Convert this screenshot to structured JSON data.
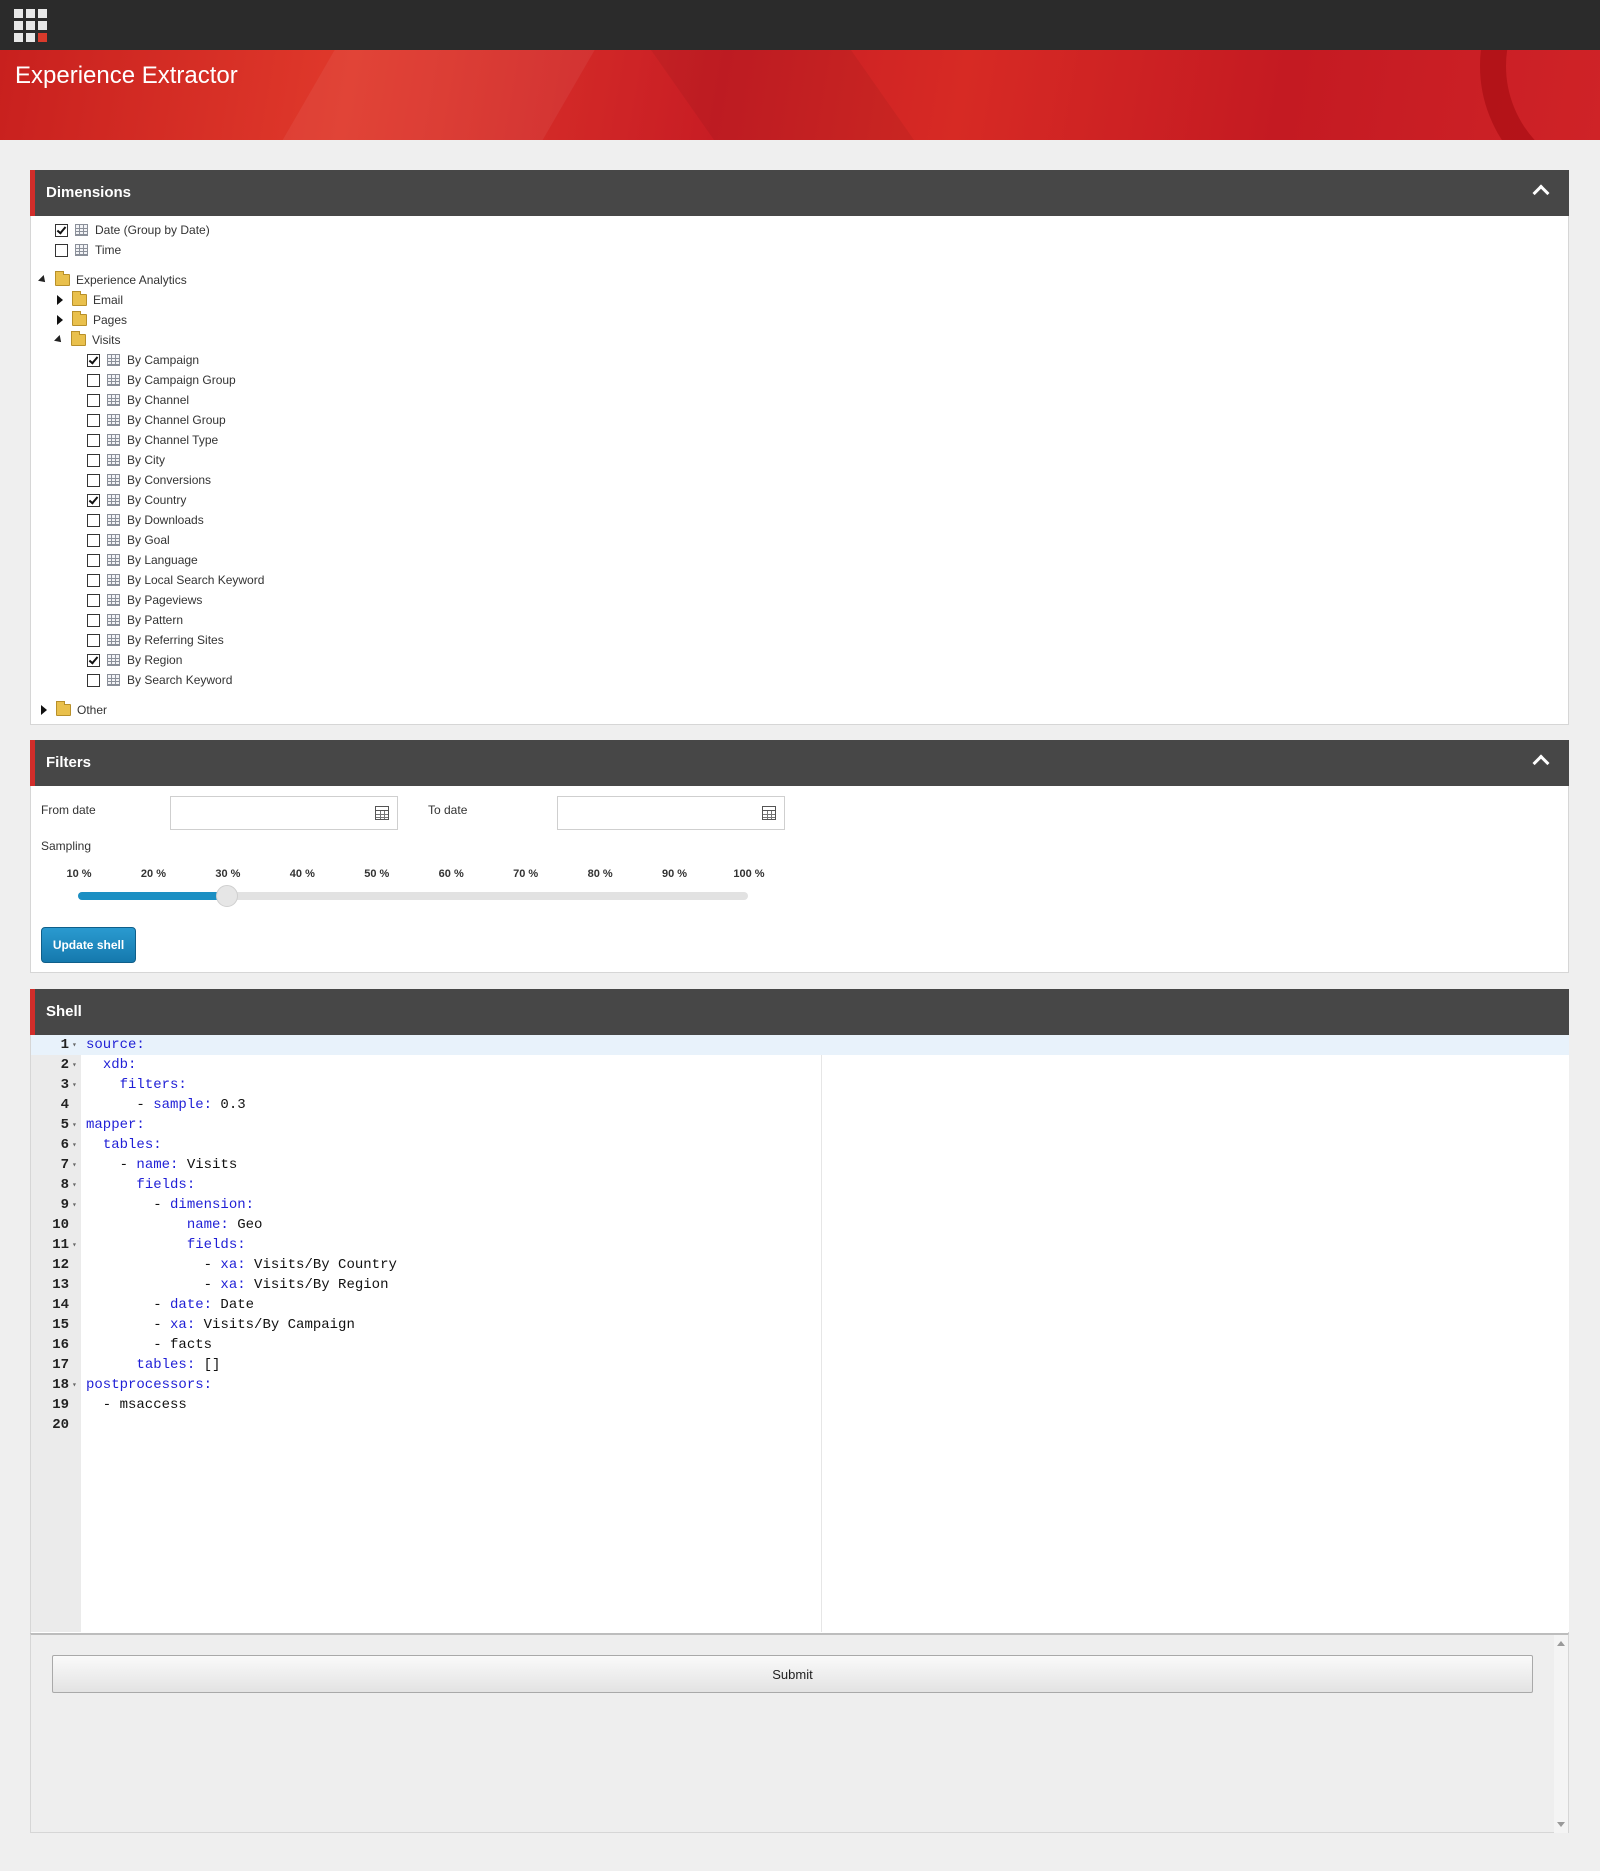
{
  "app": {
    "title": "Experience Extractor"
  },
  "dimensions": {
    "title": "Dimensions",
    "top_items": [
      {
        "label": "Date (Group by Date)",
        "checked": true
      },
      {
        "label": "Time",
        "checked": false
      }
    ],
    "folder_experience": "Experience Analytics",
    "folder_email": "Email",
    "folder_pages": "Pages",
    "folder_visits": "Visits",
    "visits_items": [
      {
        "label": "By Campaign",
        "checked": true
      },
      {
        "label": "By Campaign Group",
        "checked": false
      },
      {
        "label": "By Channel",
        "checked": false
      },
      {
        "label": "By Channel Group",
        "checked": false
      },
      {
        "label": "By Channel Type",
        "checked": false
      },
      {
        "label": "By City",
        "checked": false
      },
      {
        "label": "By Conversions",
        "checked": false
      },
      {
        "label": "By Country",
        "checked": true
      },
      {
        "label": "By Downloads",
        "checked": false
      },
      {
        "label": "By Goal",
        "checked": false
      },
      {
        "label": "By Language",
        "checked": false
      },
      {
        "label": "By Local Search Keyword",
        "checked": false
      },
      {
        "label": "By Pageviews",
        "checked": false
      },
      {
        "label": "By Pattern",
        "checked": false
      },
      {
        "label": "By Referring Sites",
        "checked": false
      },
      {
        "label": "By Region",
        "checked": true
      },
      {
        "label": "By Search Keyword",
        "checked": false
      }
    ],
    "folder_other": "Other"
  },
  "filters": {
    "title": "Filters",
    "from_label": "From date",
    "from_value": "",
    "to_label": "To date",
    "to_value": "",
    "sampling_label": "Sampling",
    "ticks": [
      "10 %",
      "20 %",
      "30 %",
      "40 %",
      "50 %",
      "60 %",
      "70 %",
      "80 %",
      "90 %",
      "100 %"
    ],
    "sampling_value": 0.3,
    "update_button": "Update shell"
  },
  "shell": {
    "title": "Shell",
    "lines": [
      {
        "n": "1",
        "fold": true,
        "parts": [
          [
            "k",
            "source:"
          ]
        ]
      },
      {
        "n": "2",
        "fold": true,
        "parts": [
          [
            "v",
            "  "
          ],
          [
            "k",
            "xdb:"
          ]
        ]
      },
      {
        "n": "3",
        "fold": true,
        "parts": [
          [
            "v",
            "    "
          ],
          [
            "k",
            "filters:"
          ]
        ]
      },
      {
        "n": "4",
        "fold": false,
        "parts": [
          [
            "v",
            "      - "
          ],
          [
            "k",
            "sample:"
          ],
          [
            "v",
            " 0.3"
          ]
        ]
      },
      {
        "n": "5",
        "fold": true,
        "parts": [
          [
            "k",
            "mapper:"
          ]
        ]
      },
      {
        "n": "6",
        "fold": true,
        "parts": [
          [
            "v",
            "  "
          ],
          [
            "k",
            "tables:"
          ]
        ]
      },
      {
        "n": "7",
        "fold": true,
        "parts": [
          [
            "v",
            "    - "
          ],
          [
            "k",
            "name:"
          ],
          [
            "v",
            " Visits"
          ]
        ]
      },
      {
        "n": "8",
        "fold": true,
        "parts": [
          [
            "v",
            "      "
          ],
          [
            "k",
            "fields:"
          ]
        ]
      },
      {
        "n": "9",
        "fold": true,
        "parts": [
          [
            "v",
            "        - "
          ],
          [
            "k",
            "dimension:"
          ]
        ]
      },
      {
        "n": "10",
        "fold": false,
        "parts": [
          [
            "v",
            "            "
          ],
          [
            "k",
            "name:"
          ],
          [
            "v",
            " Geo"
          ]
        ]
      },
      {
        "n": "11",
        "fold": true,
        "parts": [
          [
            "v",
            "            "
          ],
          [
            "k",
            "fields:"
          ]
        ]
      },
      {
        "n": "12",
        "fold": false,
        "parts": [
          [
            "v",
            "              - "
          ],
          [
            "k",
            "xa:"
          ],
          [
            "v",
            " Visits/By Country"
          ]
        ]
      },
      {
        "n": "13",
        "fold": false,
        "parts": [
          [
            "v",
            "              - "
          ],
          [
            "k",
            "xa:"
          ],
          [
            "v",
            " Visits/By Region"
          ]
        ]
      },
      {
        "n": "14",
        "fold": false,
        "parts": [
          [
            "v",
            "        - "
          ],
          [
            "k",
            "date:"
          ],
          [
            "v",
            " Date"
          ]
        ]
      },
      {
        "n": "15",
        "fold": false,
        "parts": [
          [
            "v",
            "        - "
          ],
          [
            "k",
            "xa:"
          ],
          [
            "v",
            " Visits/By Campaign"
          ]
        ]
      },
      {
        "n": "16",
        "fold": false,
        "parts": [
          [
            "v",
            "        - facts"
          ]
        ]
      },
      {
        "n": "17",
        "fold": false,
        "parts": [
          [
            "v",
            "      "
          ],
          [
            "k",
            "tables:"
          ],
          [
            "v",
            " []"
          ]
        ]
      },
      {
        "n": "18",
        "fold": true,
        "parts": [
          [
            "k",
            "postprocessors:"
          ]
        ]
      },
      {
        "n": "19",
        "fold": false,
        "parts": [
          [
            "v",
            "  - msaccess"
          ]
        ]
      },
      {
        "n": "20",
        "fold": false,
        "parts": []
      }
    ]
  },
  "submit_label": "Submit"
}
